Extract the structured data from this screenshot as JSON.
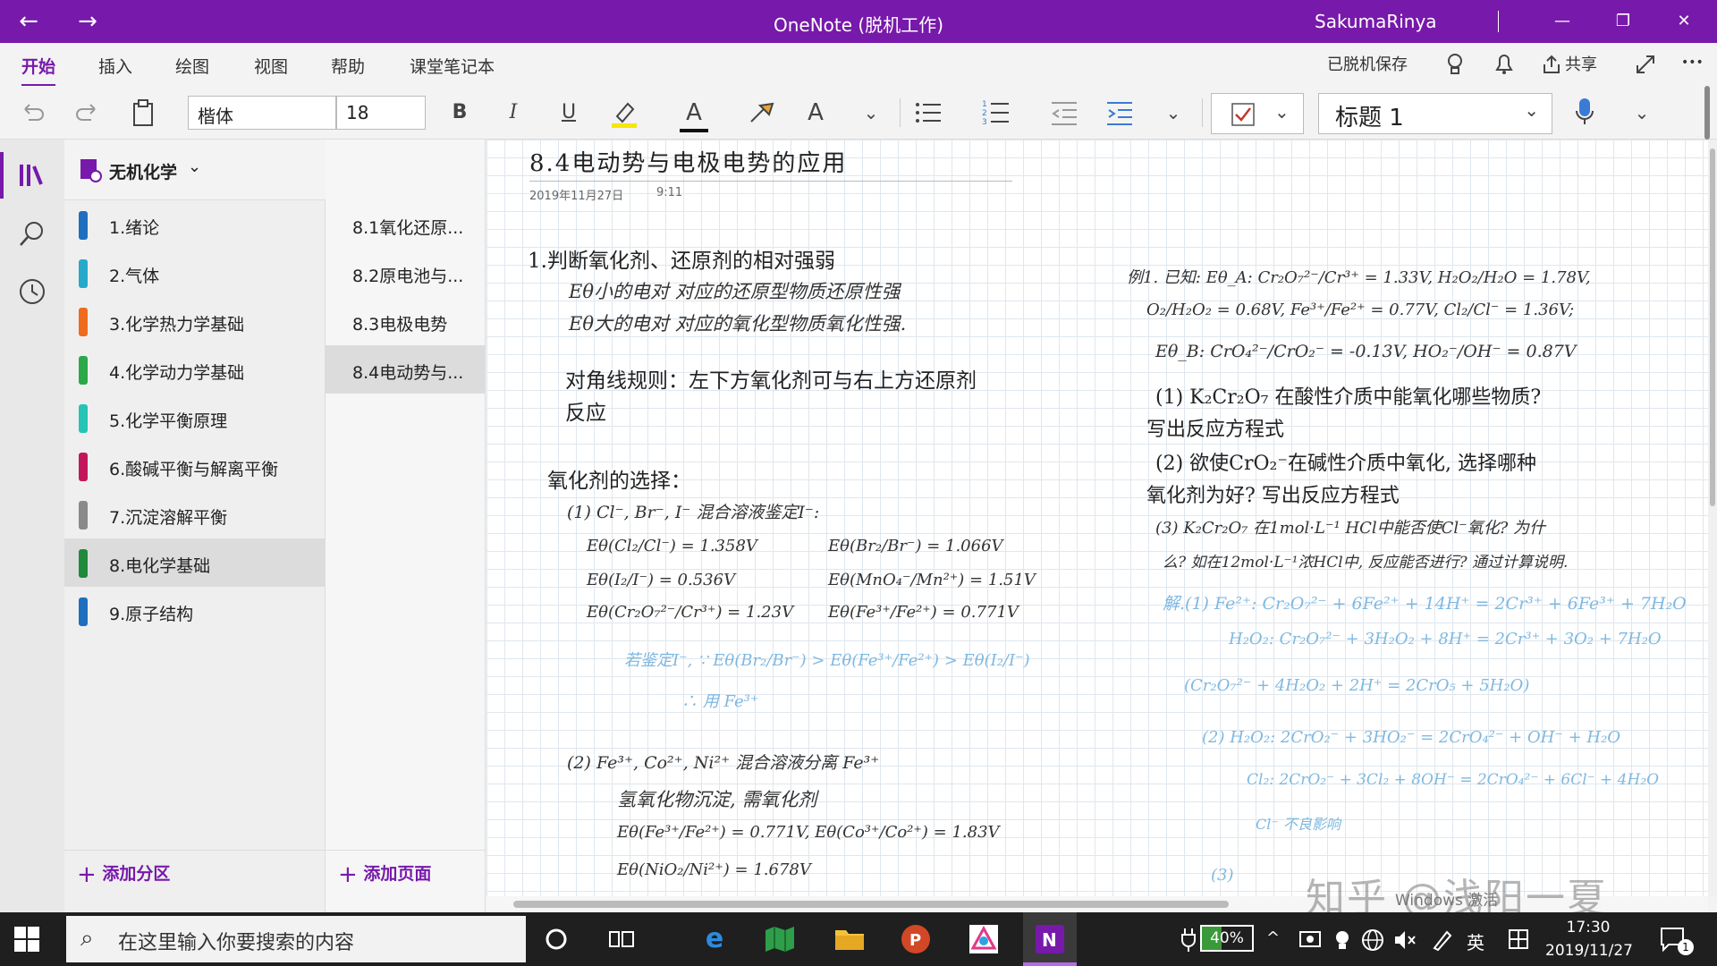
{
  "titlebar": {
    "back_icon": "←",
    "forward_icon": "→",
    "title": "OneNote (脱机工作)",
    "user": "SakumaRinya",
    "minimize_icon": "—",
    "restore_icon": "❐",
    "close_icon": "✕"
  },
  "ribbon": {
    "tabs": [
      "开始",
      "插入",
      "绘图",
      "视图",
      "帮助",
      "课堂笔记本"
    ],
    "offline_status": "已脱机保存",
    "share_label": "共享",
    "more_icon": "•••"
  },
  "toolbar": {
    "font_name": "楷体",
    "font_size": "18",
    "bold": "B",
    "italic": "I",
    "underline": "U",
    "font_color": "A",
    "clear_format": "A",
    "style_value": "标题 1",
    "chevron": "⌄"
  },
  "notebook": {
    "name": "无机化学",
    "sections": [
      {
        "label": "1.绪论",
        "color": "#1f6fbf"
      },
      {
        "label": "2.气体",
        "color": "#27a9c9"
      },
      {
        "label": "3.化学热力学基础",
        "color": "#ef6c1c"
      },
      {
        "label": "4.化学动力学基础",
        "color": "#2aa84a"
      },
      {
        "label": "5.化学平衡原理",
        "color": "#25c4b4"
      },
      {
        "label": "6.酸碱平衡与解离平衡",
        "color": "#c2185b"
      },
      {
        "label": "7.沉淀溶解平衡",
        "color": "#8a8a8a"
      },
      {
        "label": "8.电化学基础",
        "color": "#1f8a3a"
      },
      {
        "label": "9.原子结构",
        "color": "#1f6fbf"
      }
    ],
    "pages": [
      {
        "label": "8.1氧化还原..."
      },
      {
        "label": "8.2原电池与..."
      },
      {
        "label": "8.3电极电势"
      },
      {
        "label": "8.4电动势与..."
      }
    ],
    "add_section": "添加分区",
    "add_page": "添加页面"
  },
  "page": {
    "title": "8.4电动势与电极电势的应用",
    "date": "2019年11月27日",
    "time": "9:11",
    "left": [
      "1.判断氧化剂、还原剂的相对强弱",
      "Eθ小的电对 对应的还原型物质还原性强",
      "Eθ大的电对 对应的氧化型物质氧化性强.",
      "对角线规则：左下方氧化剂可与右上方还原剂",
      "反应",
      "氧化剂的选择：",
      "(1) Cl⁻, Br⁻, I⁻ 混合溶液鉴定I⁻:",
      "Eθ(Cl₂/Cl⁻) = 1.358V",
      "Eθ(Br₂/Br⁻) = 1.066V",
      "Eθ(I₂/I⁻) = 0.536V",
      "Eθ(MnO₄⁻/Mn²⁺) = 1.51V",
      "Eθ(Cr₂O₇²⁻/Cr³⁺) = 1.23V",
      "Eθ(Fe³⁺/Fe²⁺) = 0.771V",
      "若鉴定I⁻, ∵ Eθ(Br₂/Br⁻) > Eθ(Fe³⁺/Fe²⁺) > Eθ(I₂/I⁻)",
      "∴ 用 Fe³⁺",
      "(2) Fe³⁺, Co²⁺, Ni²⁺ 混合溶液分离 Fe³⁺",
      "氢氧化物沉淀, 需氧化剂",
      "Eθ(Fe³⁺/Fe²⁺) = 0.771V,  Eθ(Co³⁺/Co²⁺) = 1.83V",
      "Eθ(NiO₂/Ni²⁺) = 1.678V"
    ],
    "right": [
      "例1. 已知: Eθ_A: Cr₂O₇²⁻/Cr³⁺ = 1.33V,  H₂O₂/H₂O = 1.78V,",
      "O₂/H₂O₂ = 0.68V,  Fe³⁺/Fe²⁺ = 0.77V,  Cl₂/Cl⁻ = 1.36V;",
      "Eθ_B: CrO₄²⁻/CrO₂⁻ = -0.13V,  HO₂⁻/OH⁻ = 0.87V",
      "(1) K₂Cr₂O₇ 在酸性介质中能氧化哪些物质?",
      "写出反应方程式",
      "(2) 欲使CrO₂⁻在碱性介质中氧化, 选择哪种",
      "氧化剂为好? 写出反应方程式",
      "(3) K₂Cr₂O₇ 在1mol·L⁻¹ HCl中能否使Cl⁻氧化? 为什",
      "么? 如在12mol·L⁻¹浓HCl中, 反应能否进行? 通过计算说明.",
      "解.(1) Fe²⁺:  Cr₂O₇²⁻ + 6Fe²⁺ + 14H⁺ = 2Cr³⁺ + 6Fe³⁺ + 7H₂O",
      "H₂O₂:  Cr₂O₇²⁻ + 3H₂O₂ + 8H⁺ = 2Cr³⁺ + 3O₂ + 7H₂O",
      "(Cr₂O₇²⁻ + 4H₂O₂ + 2H⁺ = 2CrO₅ + 5H₂O)",
      "(2) H₂O₂:  2CrO₂⁻ + 3HO₂⁻ = 2CrO₄²⁻ + OH⁻ + H₂O",
      "Cl₂:  2CrO₂⁻ + 3Cl₂ + 8OH⁻ = 2CrO₄²⁻ + 6Cl⁻ + 4H₂O",
      "Cl⁻   不良影响",
      "(3)"
    ]
  },
  "taskbar": {
    "search_placeholder": "在这里输入你要搜索的内容",
    "battery": "40%",
    "battery_level": 0.4,
    "ime": "英",
    "time": "17:30",
    "date": "2019/11/27",
    "notification_count": "1",
    "win_activate": "Windows 激活",
    "watermark": "知乎 @浅阳一夏"
  }
}
